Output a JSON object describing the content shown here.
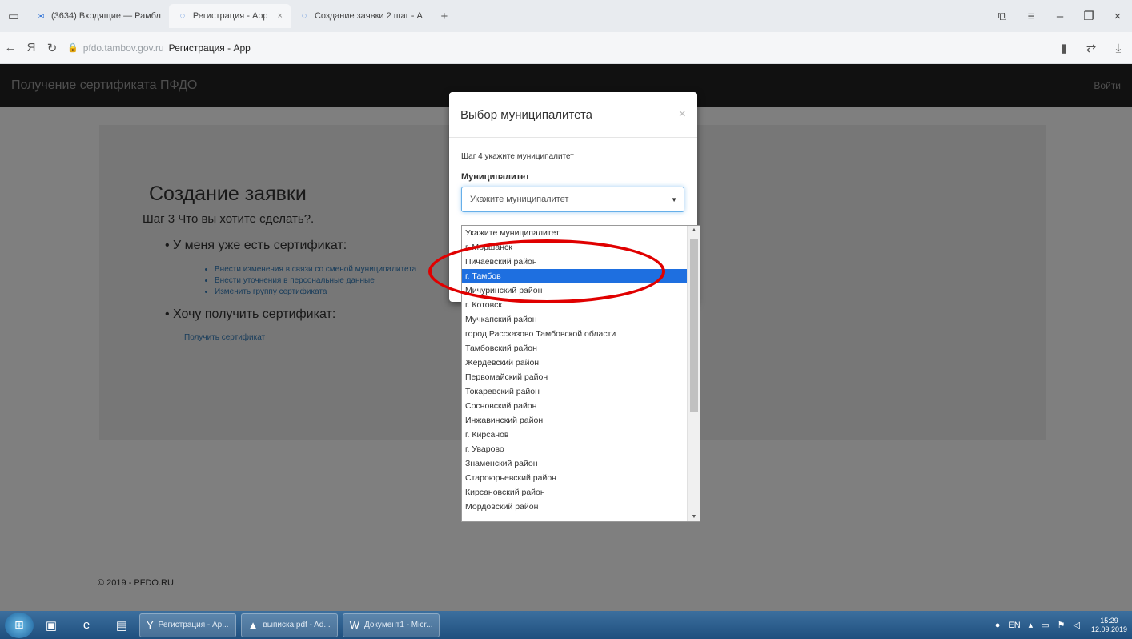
{
  "browser": {
    "tabs": [
      {
        "label": "(3634) Входящие — Рамбл",
        "icon": "mail-icon"
      },
      {
        "label": "Регистрация - App",
        "icon": "page-icon"
      },
      {
        "label": "Создание заявки 2 шаг - А",
        "icon": "page-icon"
      }
    ],
    "new_tab": "+",
    "yandex_letter": "Я",
    "url_host": "pfdo.tambov.gov.ru",
    "url_title": "Регистрация - App"
  },
  "navbar": {
    "brand": "Получение сертификата ПФДО",
    "login": "Войти"
  },
  "main": {
    "heading": "Создание заявки",
    "step": "Шаг 3 Что вы хотите сделать?.",
    "section1": "У меня уже есть сертификат:",
    "links": [
      "Внести изменения в связи со сменой муниципалитета",
      "Внести уточнения в персональные данные",
      "Изменить группу сертификата"
    ],
    "section2": "Хочу получить сертификат:",
    "get_link": "Получить сертификат"
  },
  "footer": {
    "text": "© 2019 - PFDO.RU"
  },
  "modal": {
    "title": "Выбор муниципалитета",
    "close": "×",
    "step": "Шаг 4 укажите муниципалитет",
    "label": "Муниципалитет",
    "placeholder": "Укажите муниципалитет",
    "options": [
      "Укажите муниципалитет",
      "г. Моршанск",
      "Пичаевский район",
      "г. Тамбов",
      "Мичуринский район",
      "г. Котовск",
      "Мучкапский район",
      "город Рассказово Тамбовской области",
      "Тамбовский район",
      "Жердевский район",
      "Первомайский район",
      "Токаревский район",
      "Сосновский район",
      "Инжавинский район",
      "г. Кирсанов",
      "г. Уварово",
      "Знаменский район",
      "Староюрьевский район",
      "Кирсановский район",
      "Мордовский район"
    ],
    "highlighted": "г. Тамбов"
  },
  "taskbar": {
    "tasks": [
      {
        "label": "Регистрация - Ap...",
        "icon": "yandex-icon"
      },
      {
        "label": "выписка.pdf - Ad...",
        "icon": "pdf-icon"
      },
      {
        "label": "Документ1 - Micr...",
        "icon": "word-icon"
      }
    ],
    "lang": "EN",
    "time": "15:29",
    "date": "12.09.2019"
  },
  "colors": {
    "navbar": "#222222",
    "highlight": "#1e6fe0",
    "annotation": "#e00000",
    "link": "#337ab7"
  }
}
